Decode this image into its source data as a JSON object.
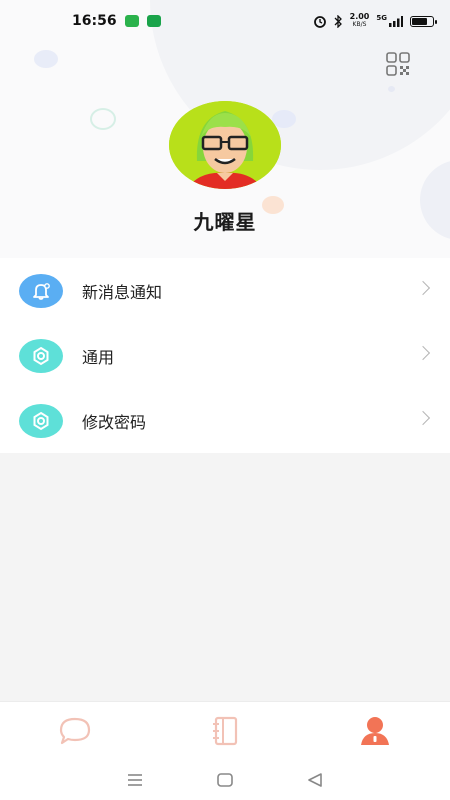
{
  "status_bar": {
    "time": "16:56",
    "network_speed_value": "2.00",
    "network_speed_unit": "KB/S",
    "network_type": "5G",
    "icons": [
      "message-app-icon",
      "phone-app-icon",
      "alarm-icon",
      "bluetooth-icon",
      "signal-icon",
      "battery-icon"
    ],
    "battery_level": 0.8
  },
  "profile": {
    "name": "九曜星",
    "avatar_icon": "cartoon-avatar-icon",
    "qr_icon": "qr-code-icon"
  },
  "menu": {
    "items": [
      {
        "label": "新消息通知",
        "icon": "bell-icon",
        "color": "#5aaef3"
      },
      {
        "label": "通用",
        "icon": "gear-icon",
        "color": "#5ee0d8"
      },
      {
        "label": "修改密码",
        "icon": "gear-icon",
        "color": "#5ee0d8"
      }
    ]
  },
  "tabbar": {
    "tabs": [
      {
        "icon": "chat-bubble-icon",
        "active": false
      },
      {
        "icon": "contacts-book-icon",
        "active": false
      },
      {
        "icon": "person-icon",
        "active": true
      }
    ],
    "inactive_color": "#f2c2b6",
    "active_color": "#f27456"
  },
  "navbar": {
    "buttons": [
      "menu-nav-icon",
      "home-nav-icon",
      "back-nav-icon"
    ]
  }
}
